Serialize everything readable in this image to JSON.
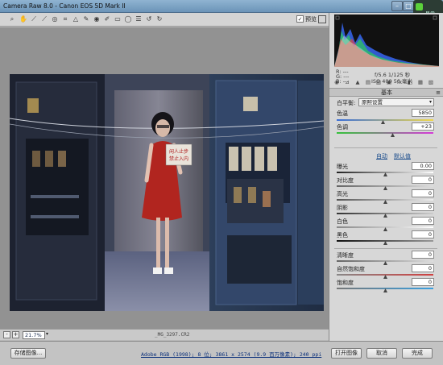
{
  "window": {
    "title": "Camera Raw 8.0 - Canon EOS 5D Mark II",
    "badge_label": "显示"
  },
  "toolbar": {
    "preview_label": "预览",
    "preview_checked": "✓"
  },
  "zoom": {
    "minus": "-",
    "plus": "+",
    "level": "21.7%",
    "arrow": "▾"
  },
  "image": {
    "filename": "_MG_3297.CR2",
    "sign_text_1": "闲人止步",
    "sign_text_2": "禁止入内"
  },
  "readout": {
    "r": "R:  ---",
    "g": "G:  ---",
    "b": "B:  ---",
    "aperture_shutter": "f/5.6   1/125 秒",
    "iso_focal": "ISO 400   50 毫米"
  },
  "panel": {
    "header": "基本",
    "menu_icon": "≡",
    "white_balance_label": "白平衡:",
    "white_balance_value": "原照设置",
    "temperature_label": "色温",
    "temperature_value": "5850",
    "tint_label": "色调",
    "tint_value": "+23",
    "auto_label": "自动",
    "default_label": "默认值",
    "exposure_label": "曝光",
    "exposure_value": "0.00",
    "contrast_label": "对比度",
    "contrast_value": "0",
    "highlights_label": "高光",
    "highlights_value": "0",
    "shadows_label": "阴影",
    "shadows_value": "0",
    "whites_label": "白色",
    "whites_value": "0",
    "blacks_label": "黑色",
    "blacks_value": "0",
    "clarity_label": "清晰度",
    "clarity_value": "0",
    "vibrance_label": "自然饱和度",
    "vibrance_value": "0",
    "saturation_label": "饱和度",
    "saturation_value": "0"
  },
  "bottom": {
    "save_label": "存储图像...",
    "workflow": "Adobe RGB (1998); 8 位; 3861 x 2574 (9.9 百万像素); 240 ppi",
    "open_label": "打开图像",
    "cancel_label": "取消",
    "done_label": "完成"
  },
  "icons": {
    "zoom": "zoom-icon",
    "hand": "hand-icon",
    "white-balance": "white-balance-icon",
    "color-sampler": "color-sampler-icon",
    "targeted-adjust": "targeted-adjustment-icon",
    "crop": "crop-icon",
    "straighten": "straighten-icon",
    "spot-removal": "spot-removal-icon",
    "red-eye": "red-eye-icon",
    "adjust-brush": "adjustment-brush-icon",
    "grad-filter": "graduated-filter-icon",
    "radial-filter": "radial-filter-icon",
    "preferences": "preferences-icon",
    "rotate-ccw": "rotate-ccw-icon",
    "rotate-cw": "rotate-cw-icon"
  },
  "colors": {
    "dress_red": "#b1251f",
    "cabinet_blue": "#2c3e58",
    "link_blue": "#1a4c8c"
  }
}
